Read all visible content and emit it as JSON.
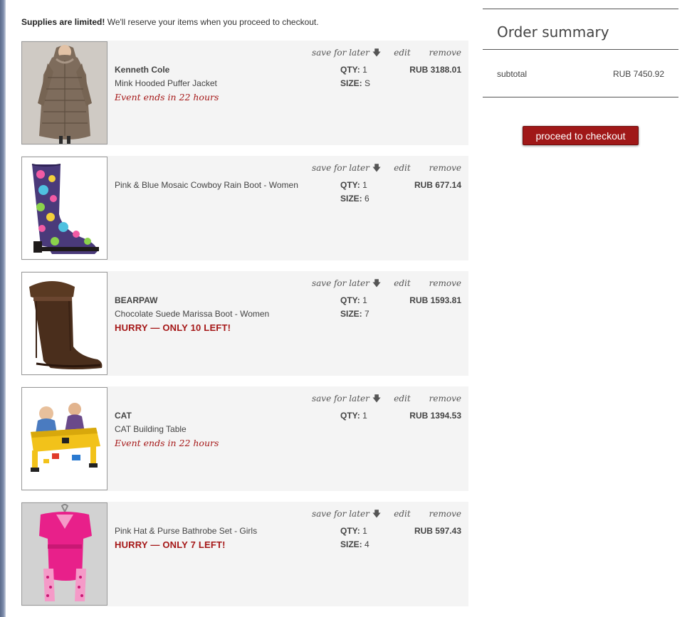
{
  "notice": {
    "bold": "Supplies are limited!",
    "text": " We'll reserve your items when you proceed to checkout."
  },
  "actions": {
    "save_for_later": "save for later",
    "save_icon": "down-arrow-icon",
    "edit": "edit",
    "remove": "remove"
  },
  "labels": {
    "qty": "QTY:",
    "size": "SIZE:"
  },
  "items": [
    {
      "brand": "Kenneth Cole",
      "name": "Mink Hooded Puffer Jacket",
      "event": "Event ends in 22 hours",
      "qty": "1",
      "size": "S",
      "price": "RUB 3188.01"
    },
    {
      "name": "Pink & Blue Mosaic Cowboy Rain Boot - Women",
      "qty": "1",
      "size": "6",
      "price": "RUB 677.14"
    },
    {
      "brand": "BEARPAW",
      "name": "Chocolate Suede Marissa Boot - Women",
      "hurry": "HURRY — ONLY 10 LEFT!",
      "qty": "1",
      "size": "7",
      "price": "RUB 1593.81"
    },
    {
      "brand": "CAT",
      "name": "CAT Building Table",
      "event": "Event ends in 22 hours",
      "qty": "1",
      "price": "RUB 1394.53"
    },
    {
      "name": "Pink Hat & Purse Bathrobe Set - Girls",
      "hurry": "HURRY — ONLY 7 LEFT!",
      "qty": "1",
      "size": "4",
      "price": "RUB 597.43"
    }
  ],
  "summary": {
    "title": "Order summary",
    "subtotal_label": "subtotal",
    "subtotal_value": "RUB 7450.92"
  },
  "checkout_label": "proceed to checkout",
  "colors": {
    "accent_red": "#a01818",
    "alert_red": "#a51717",
    "row_bg": "#f4f4f4"
  }
}
